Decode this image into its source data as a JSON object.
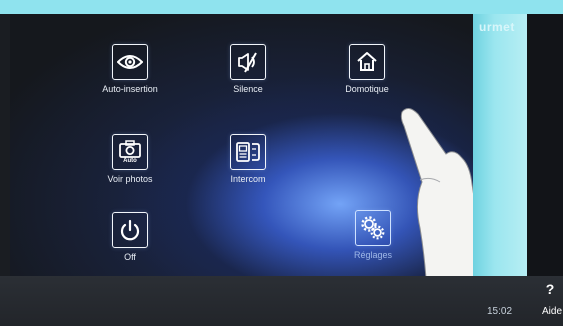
{
  "brand": "urmet",
  "tiles": [
    {
      "label": "Auto-insertion",
      "icon": "eye-icon"
    },
    {
      "label": "Silence",
      "icon": "muted-bell-icon"
    },
    {
      "label": "Domotique",
      "icon": "home-icon"
    },
    {
      "label": "Voir photos",
      "icon": "camera-icon",
      "badge": "Auto"
    },
    {
      "label": "Intercom",
      "icon": "intercom-phone-icon"
    },
    {
      "label": "Off",
      "icon": "power-icon"
    },
    {
      "label": "Réglages",
      "icon": "gears-icon"
    }
  ],
  "status": {
    "time": "15:02"
  },
  "help": {
    "symbol": "?",
    "label": "Aide"
  }
}
